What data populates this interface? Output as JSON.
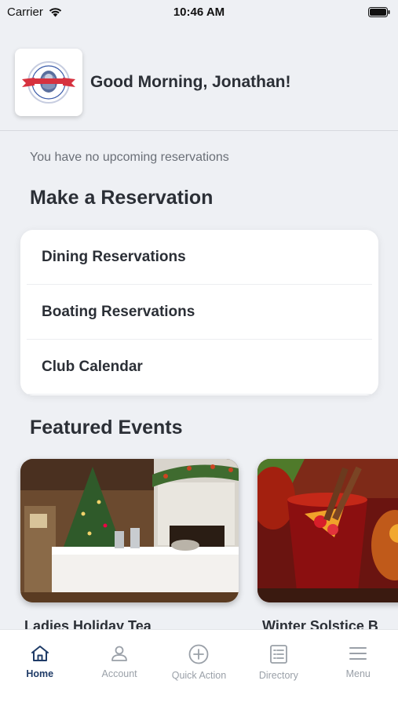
{
  "status": {
    "carrier": "Carrier",
    "time": "10:46 AM"
  },
  "header": {
    "greeting": "Good Morning, Jonathan!"
  },
  "reservations": {
    "empty_message": "You have no upcoming reservations",
    "title": "Make a Reservation",
    "items": [
      {
        "label": "Dining Reservations"
      },
      {
        "label": "Boating Reservations"
      },
      {
        "label": "Club Calendar"
      }
    ]
  },
  "events": {
    "title": "Featured Events",
    "items": [
      {
        "title": "Ladies Holiday Tea"
      },
      {
        "title": "Winter Solstice B"
      }
    ]
  },
  "tabs": [
    {
      "label": "Home",
      "icon": "home-icon",
      "active": true
    },
    {
      "label": "Account",
      "icon": "account-icon",
      "active": false
    },
    {
      "label": "Quick Action",
      "icon": "plus-circle-icon",
      "active": false
    },
    {
      "label": "Directory",
      "icon": "directory-icon",
      "active": false
    },
    {
      "label": "Menu",
      "icon": "menu-icon",
      "active": false
    }
  ],
  "colors": {
    "accent": "#1f3b67",
    "background": "#eef0f4",
    "inactive": "#9aa0a8"
  }
}
